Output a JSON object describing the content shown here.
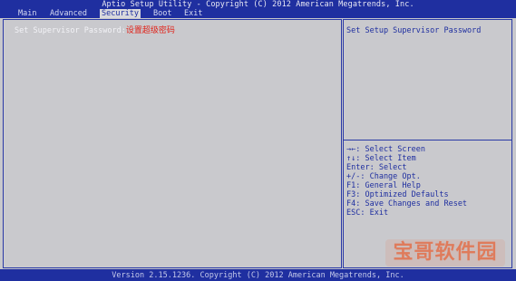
{
  "title": "Aptio Setup Utility - Copyright (C) 2012 American Megatrends, Inc.",
  "menu": {
    "items": [
      {
        "label": "Main"
      },
      {
        "label": "Advanced"
      },
      {
        "label": "Security"
      },
      {
        "label": "Boot"
      },
      {
        "label": "Exit"
      }
    ],
    "active": "Security"
  },
  "main": {
    "setting_label": "Set Supervisor Password:",
    "setting_annotation": "设置超级密码"
  },
  "help": {
    "description": "Set Setup Supervisor Password",
    "keys": [
      "→←: Select Screen",
      "↑↓: Select Item",
      "Enter: Select",
      "+/-: Change Opt.",
      "F1: General Help",
      "F3: Optimized Defaults",
      "F4: Save Changes and Reset",
      "ESC: Exit"
    ]
  },
  "footer": "Version 2.15.1236. Copyright (C) 2012 American Megatrends, Inc.",
  "watermark": "宝哥软件园",
  "colors": {
    "bar_blue": "#1f2fa0",
    "panel_gray": "#c9c9cd",
    "annotation_red": "#e0231a"
  }
}
